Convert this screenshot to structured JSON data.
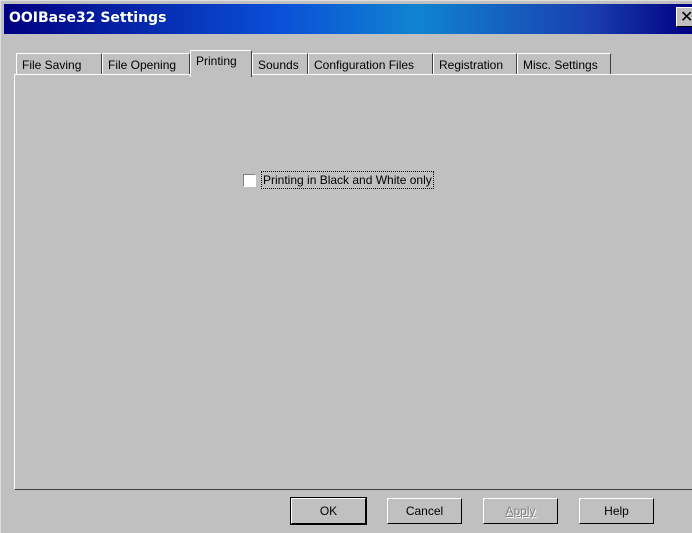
{
  "window": {
    "title": "OOIBase32 Settings",
    "close_glyph": "✕"
  },
  "tabs": [
    {
      "label": "File Saving",
      "active": false
    },
    {
      "label": "File Opening",
      "active": false
    },
    {
      "label": "Printing",
      "active": true
    },
    {
      "label": "Sounds",
      "active": false
    },
    {
      "label": "Configuration Files",
      "active": false
    },
    {
      "label": "Registration",
      "active": false
    },
    {
      "label": "Misc. Settings",
      "active": false
    }
  ],
  "printing": {
    "bw_only_label": "Printing in Black and White only",
    "bw_only_checked": false
  },
  "buttons": {
    "ok": "OK",
    "cancel": "Cancel",
    "apply": "Apply",
    "help": "Help"
  },
  "colors": {
    "title_bar_start": "#000080",
    "title_bar_end": "#1084d0",
    "face": "#c0c0c0"
  }
}
